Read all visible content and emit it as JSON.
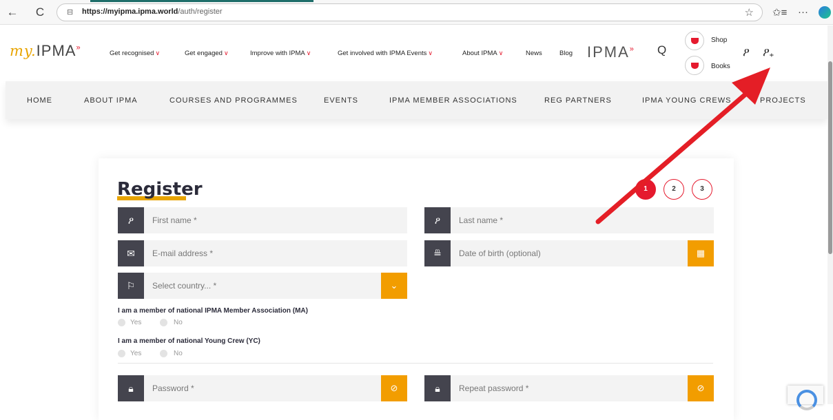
{
  "browser": {
    "back": "←",
    "refresh": "C",
    "lock": "🔒",
    "url_domain": "https://myipma.ipma.world",
    "url_path": "/auth/register",
    "star": "☆",
    "favorites": "✩≡",
    "more": "···"
  },
  "header": {
    "logo_my": "my.",
    "logo_main": "IPMA",
    "logo_mark": "»",
    "menu": [
      {
        "label": "Get recognised",
        "chevron": "∨"
      },
      {
        "label": "Get engaged",
        "chevron": "∨"
      },
      {
        "label": "Improve with IPMA",
        "chevron": "∨"
      },
      {
        "label": "Get involved with IPMA Events",
        "chevron": "∨"
      },
      {
        "label": "About IPMA",
        "chevron": "∨"
      },
      {
        "label": "News",
        "chevron": ""
      },
      {
        "label": "Blog",
        "chevron": ""
      }
    ],
    "ipma_logo": "IPMA",
    "ipma_mark": "»",
    "search": "Q",
    "shop_label": "Shop",
    "books_label": "Books",
    "user_icon": "ዖ",
    "user_add_icon": "ዖ₊"
  },
  "subnav": {
    "items": [
      "HOME",
      "ABOUT IPMA",
      "COURSES AND PROGRAMMES",
      "EVENTS",
      "IPMA MEMBER ASSOCIATIONS",
      "REG PARTNERS",
      "IPMA YOUNG CREWS",
      "PROJECTS"
    ]
  },
  "form": {
    "title": "Register",
    "steps": [
      "1",
      "2",
      "3"
    ],
    "active_step": 1,
    "first_name": "First name *",
    "last_name": "Last name *",
    "email": "E-mail address *",
    "dob": "Date of birth (optional)",
    "country": "Select country... *",
    "question_ma": "I am a member of national IPMA Member Association (MA)",
    "question_yc": "I am a member of national Young Crew (YC)",
    "yes": "Yes",
    "no": "No",
    "password": "Password *",
    "repeat_password": "Repeat password *"
  },
  "colors": {
    "accent_orange": "#f29d00",
    "accent_red": "#e51a2e",
    "dark_icon": "#44444e",
    "arrow": "#e41e26"
  }
}
